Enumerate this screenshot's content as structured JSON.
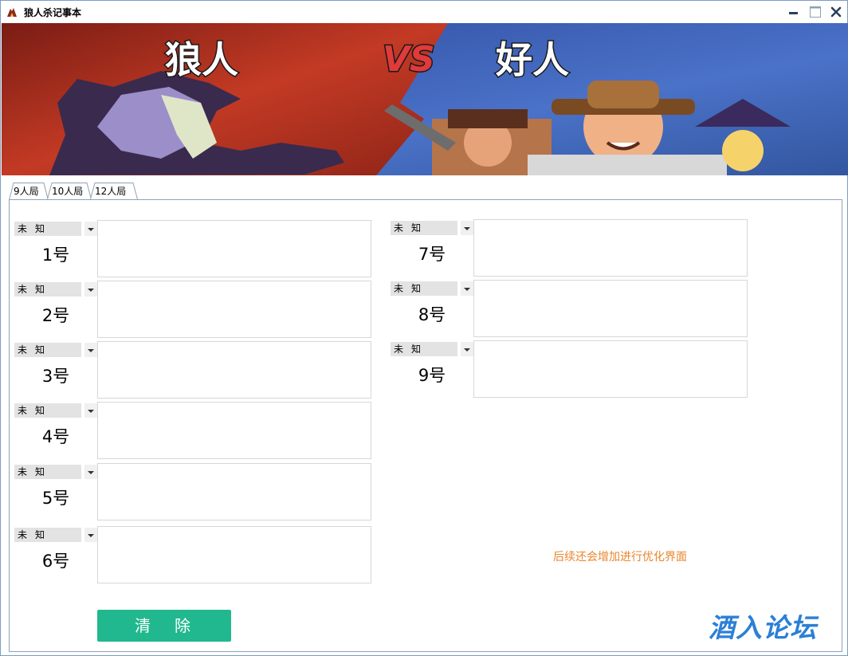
{
  "window": {
    "title": "狼人杀记事本",
    "minimize_icon": "minimize-icon",
    "maximize_icon": "maximize-icon",
    "close_icon": "close-icon"
  },
  "banner": {
    "left_text": "狼人",
    "vs_text": "VS",
    "right_text": "好人"
  },
  "tabs": [
    {
      "label": "9人局",
      "active": true
    },
    {
      "label": "10人局",
      "active": false
    },
    {
      "label": "12人局",
      "active": false
    }
  ],
  "players": [
    {
      "label": "1号",
      "role": "未知",
      "notes": ""
    },
    {
      "label": "2号",
      "role": "未知",
      "notes": ""
    },
    {
      "label": "3号",
      "role": "未知",
      "notes": ""
    },
    {
      "label": "4号",
      "role": "未知",
      "notes": ""
    },
    {
      "label": "5号",
      "role": "未知",
      "notes": ""
    },
    {
      "label": "6号",
      "role": "未知",
      "notes": ""
    },
    {
      "label": "7号",
      "role": "未知",
      "notes": ""
    },
    {
      "label": "8号",
      "role": "未知",
      "notes": ""
    },
    {
      "label": "9号",
      "role": "未知",
      "notes": ""
    }
  ],
  "hint": "后续还会增加进行优化界面",
  "clear_button": "清除",
  "watermark": "酒入论坛",
  "colors": {
    "accent_button": "#22b88f",
    "hint_text": "#e9862c",
    "watermark": "#2c7fd6",
    "banner_left": "#b0301f",
    "banner_right": "#3a5fb4"
  }
}
